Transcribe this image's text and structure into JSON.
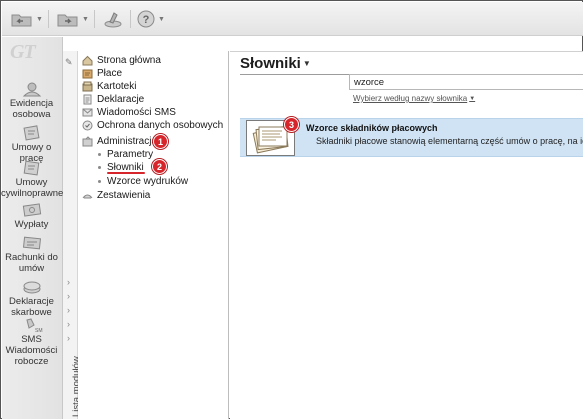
{
  "toolbar": {
    "buttons": [
      {
        "icon": "folder-back-icon"
      },
      {
        "icon": "folder-forward-icon"
      },
      {
        "icon": "tools-icon"
      },
      {
        "icon": "help-icon"
      }
    ]
  },
  "logo": {
    "text": "GT"
  },
  "modules": [
    {
      "icon": "employee-records-icon",
      "label": "Ewidencja osobowa"
    },
    {
      "icon": "employment-contract-icon",
      "label": "Umowy o pracę"
    },
    {
      "icon": "civil-contract-icon",
      "label": "Umowy cywilnoprawne"
    },
    {
      "icon": "payouts-icon",
      "label": "Wypłaty"
    },
    {
      "icon": "bank-accounts-icon",
      "label": "Rachunki do umów"
    },
    {
      "icon": "tax-declarations-icon",
      "label": "Deklaracje skarbowe"
    },
    {
      "icon": "sms-icon",
      "label": "SMS Wiadomości robocze"
    }
  ],
  "side_strip": {
    "label": "Lista modułów"
  },
  "tree": {
    "items": [
      {
        "label": "Strona główna",
        "icon": "home-icon"
      },
      {
        "label": "Płace",
        "icon": "payroll-icon"
      },
      {
        "label": "Kartoteki",
        "icon": "records-icon"
      },
      {
        "label": "Deklaracje",
        "icon": "declarations-icon"
      },
      {
        "label": "Wiadomości SMS",
        "icon": "sms-message-icon"
      },
      {
        "label": "Ochrona danych osobowych",
        "icon": "data-protection-icon"
      },
      {
        "label": "Administracja",
        "icon": "administration-icon"
      },
      {
        "label": "Parametry",
        "icon": "bullet-icon"
      },
      {
        "label": "Słowniki",
        "icon": "bullet-icon"
      },
      {
        "label": "Wzorce wydruków",
        "icon": "bullet-icon"
      },
      {
        "label": "Zestawienia",
        "icon": "reports-icon"
      }
    ]
  },
  "markers": [
    "1",
    "2",
    "3"
  ],
  "main": {
    "title": "Słowniki",
    "search_value": "wzorce",
    "filter_link": "Wybierz według nazwy słownika",
    "result": {
      "title": "Wzorce składników płacowych",
      "description": "Składniki płacowe stanowią elementarną część umów o pracę, na ich"
    }
  },
  "colors": {
    "accent_red": "#d7262b",
    "selection_blue": "#cfe3f4"
  }
}
